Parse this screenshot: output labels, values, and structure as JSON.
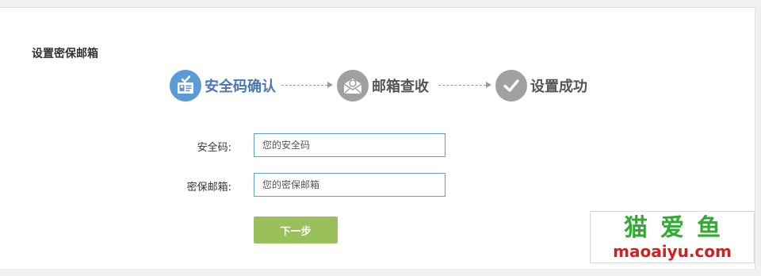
{
  "panel": {
    "title": "设置密保邮箱"
  },
  "steps": [
    {
      "label": "安全码确认",
      "state": "active",
      "icon": "id-card-check-icon"
    },
    {
      "label": "邮箱查收",
      "state": "pending",
      "icon": "mail-open-icon"
    },
    {
      "label": "设置成功",
      "state": "pending",
      "icon": "check-circle-icon"
    }
  ],
  "form": {
    "security_code": {
      "label": "安全码:",
      "placeholder": "您的安全码",
      "value": ""
    },
    "email": {
      "label": "密保邮箱:",
      "placeholder": "您的密保邮箱",
      "value": ""
    },
    "next_label": "下一步"
  },
  "watermark": {
    "cn": "猫爱鱼",
    "en": "maoaiyu.com"
  },
  "colors": {
    "active_step": "#5b9bd5",
    "pending_step": "#a0a0a0",
    "button": "#99c05a",
    "input_border": "#5fa1c5"
  }
}
